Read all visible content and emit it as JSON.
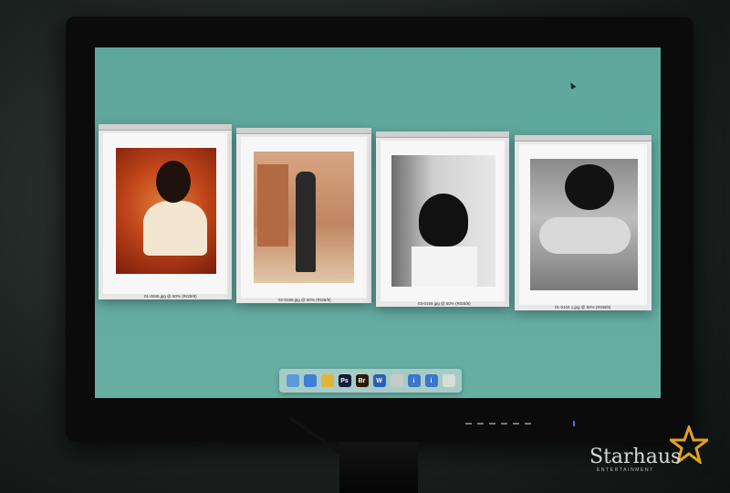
{
  "documents": [
    {
      "caption": "01-0046.jpg @ 50% (RGB/8)"
    },
    {
      "caption": "02-0169.jpg @ 50% (RGB/8)"
    },
    {
      "caption": "03-0169.jpg @ 50% (RGB/8)"
    },
    {
      "caption": "01-0104 1.jpg @ 50% (RGB/8)"
    }
  ],
  "dock": {
    "items": [
      {
        "name": "finder-icon",
        "glyph": "",
        "color": "#5a9bd8"
      },
      {
        "name": "safari-icon",
        "glyph": "",
        "color": "#3d7fd6"
      },
      {
        "name": "chrome-icon",
        "glyph": "",
        "color": "#e2b33a"
      },
      {
        "name": "photoshop-icon",
        "glyph": "Ps",
        "color": "#0f1c3a"
      },
      {
        "name": "bridge-icon",
        "glyph": "Br",
        "color": "#2a1a0a"
      },
      {
        "name": "word-icon",
        "glyph": "W",
        "color": "#2b5fb8"
      },
      {
        "name": "pencil-app-icon",
        "glyph": "",
        "color": "#c9c9c9"
      },
      {
        "name": "info-app-icon",
        "glyph": "i",
        "color": "#3b76c9"
      },
      {
        "name": "info-app-2-icon",
        "glyph": "i",
        "color": "#3b76c9"
      },
      {
        "name": "trash-icon",
        "glyph": "",
        "color": "#d7dcdc"
      }
    ]
  },
  "watermark": {
    "brand": "Starhaus",
    "tagline": "ENTERTAINMENT",
    "star_color": "#e3a21a"
  }
}
